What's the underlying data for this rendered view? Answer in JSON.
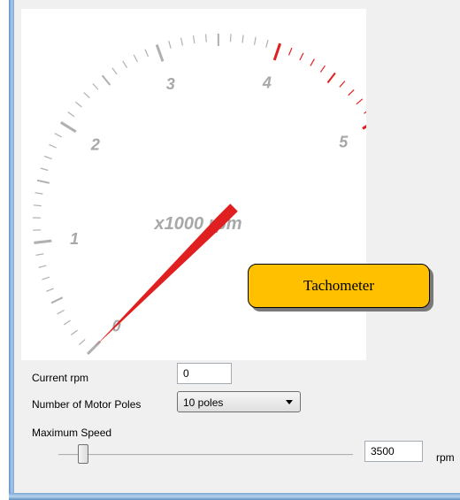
{
  "gauge": {
    "scale_labels": [
      "0",
      "1",
      "2",
      "3",
      "4",
      "5"
    ],
    "unit_label": "x1000 rpm",
    "needle_value_rpm": 0,
    "redline_color": "#e02020",
    "tick_color": "#b0b0b0",
    "label_color": "#a8a8a8"
  },
  "controls": {
    "current_rpm_label": "Current rpm",
    "current_rpm_value": "0",
    "motor_poles_label": "Number of Motor Poles",
    "motor_poles_value": "10 poles",
    "max_speed_label": "Maximum Speed",
    "max_speed_value": "3500",
    "rpm_unit": "rpm"
  },
  "callout": {
    "text": "Tachometer",
    "color": "#ffc000"
  }
}
